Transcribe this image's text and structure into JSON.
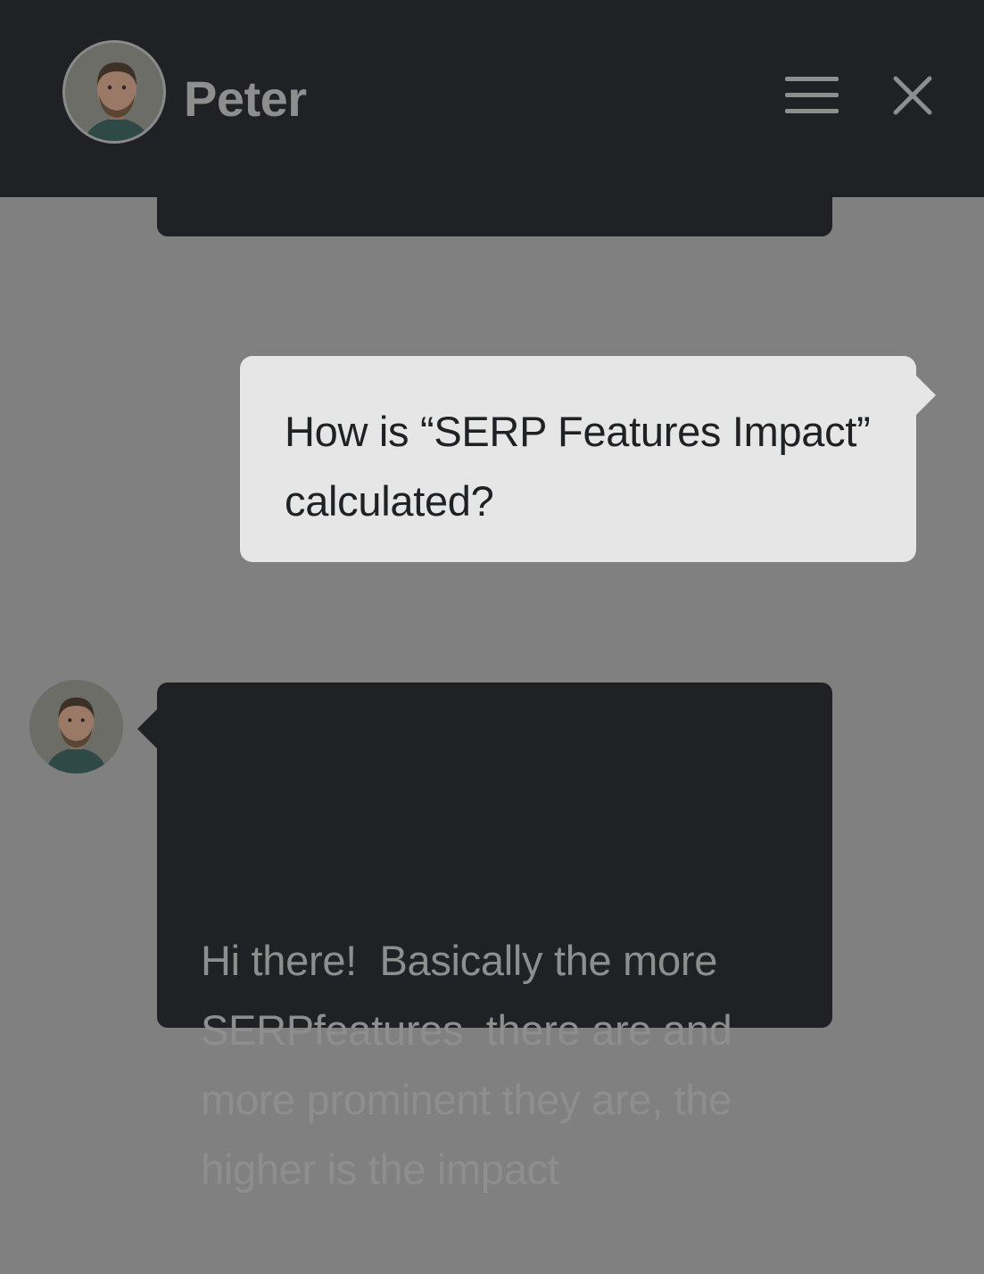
{
  "header": {
    "agent_name": "Peter",
    "avatar_icon": "person-avatar",
    "menu_icon": "hamburger-menu-icon",
    "close_icon": "close-icon"
  },
  "messages": [
    {
      "sender": "user",
      "text": "How is “SERP Features Impact” calculated?"
    },
    {
      "sender": "agent",
      "text": "Hi there!  Basically the more SERPfeatures  there are and more prominent they are, the higher is the impact"
    }
  ],
  "colors": {
    "overlay_background": "#808080",
    "header_background": "#1f2124",
    "user_bubble": "#e6e6e6",
    "agent_bubble": "#1f2124",
    "muted_text": "#8e8e8e"
  }
}
